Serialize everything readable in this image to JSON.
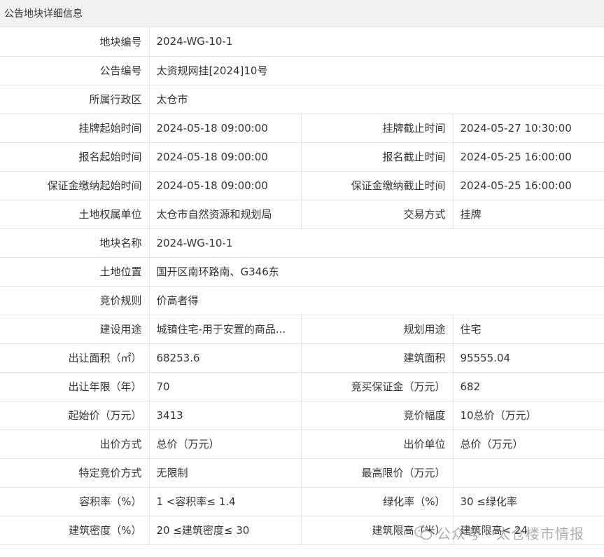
{
  "header": {
    "title": "公告地块详细信息"
  },
  "rows": [
    {
      "cells": [
        {
          "label": "地块编号",
          "value": "2024-WG-10-1"
        }
      ]
    },
    {
      "cells": [
        {
          "label": "公告编号",
          "value": "太资规网挂[2024]10号"
        }
      ]
    },
    {
      "cells": [
        {
          "label": "所属行政区",
          "value": "太仓市"
        }
      ]
    },
    {
      "cells": [
        {
          "label": "挂牌起始时间",
          "value": "2024-05-18 09:00:00"
        },
        {
          "label": "挂牌截止时间",
          "value": "2024-05-27 10:30:00"
        }
      ]
    },
    {
      "cells": [
        {
          "label": "报名起始时间",
          "value": "2024-05-18 09:00:00"
        },
        {
          "label": "报名截止时间",
          "value": "2024-05-25 16:00:00"
        }
      ]
    },
    {
      "cells": [
        {
          "label": "保证金缴纳起始时间",
          "value": "2024-05-18 09:00:00"
        },
        {
          "label": "保证金缴纳截止时间",
          "value": "2024-05-25 16:00:00"
        }
      ]
    },
    {
      "cells": [
        {
          "label": "土地权属单位",
          "value": "太仓市自然资源和规划局"
        },
        {
          "label": "交易方式",
          "value": "挂牌"
        }
      ]
    },
    {
      "cells": [
        {
          "label": "地块名称",
          "value": "2024-WG-10-1"
        }
      ]
    },
    {
      "cells": [
        {
          "label": "土地位置",
          "value": "国开区南环路南、G346东"
        }
      ]
    },
    {
      "cells": [
        {
          "label": "竞价规则",
          "value": "价高者得"
        }
      ]
    },
    {
      "cells": [
        {
          "label": "建设用途",
          "value": "城镇住宅-用于安置的商品..."
        },
        {
          "label": "规划用途",
          "value": "住宅"
        }
      ]
    },
    {
      "cells": [
        {
          "label": "出让面积（㎡）",
          "value": "68253.6"
        },
        {
          "label": "建筑面积",
          "value": "95555.04"
        }
      ]
    },
    {
      "cells": [
        {
          "label": "出让年限（年）",
          "value": "70"
        },
        {
          "label": "竞买保证金（万元）",
          "value": "682"
        }
      ]
    },
    {
      "cells": [
        {
          "label": "起始价（万元）",
          "value": "3413"
        },
        {
          "label": "竞价幅度",
          "value": "10总价（万元）"
        }
      ]
    },
    {
      "cells": [
        {
          "label": "出价方式",
          "value": "总价（万元）"
        },
        {
          "label": "出价单位",
          "value": "总价（万元）"
        }
      ]
    },
    {
      "cells": [
        {
          "label": "特定竞价方式",
          "value": "无限制"
        },
        {
          "label": "最高限价（万元）",
          "value": ""
        }
      ]
    },
    {
      "cells": [
        {
          "label": "容积率（%）",
          "value": "1 <容积率≤ 1.4"
        },
        {
          "label": "绿化率（%）",
          "value": "30 ≤绿化率"
        }
      ]
    },
    {
      "cells": [
        {
          "label": "建筑密度（%）",
          "value": "20 ≤建筑密度≤ 30"
        },
        {
          "label": "建筑限高（米）",
          "value": "建筑限高< 24"
        }
      ]
    }
  ],
  "watermark": {
    "text": "公众号 · 太仓楼市情报",
    "icon": "wechat-icon"
  }
}
